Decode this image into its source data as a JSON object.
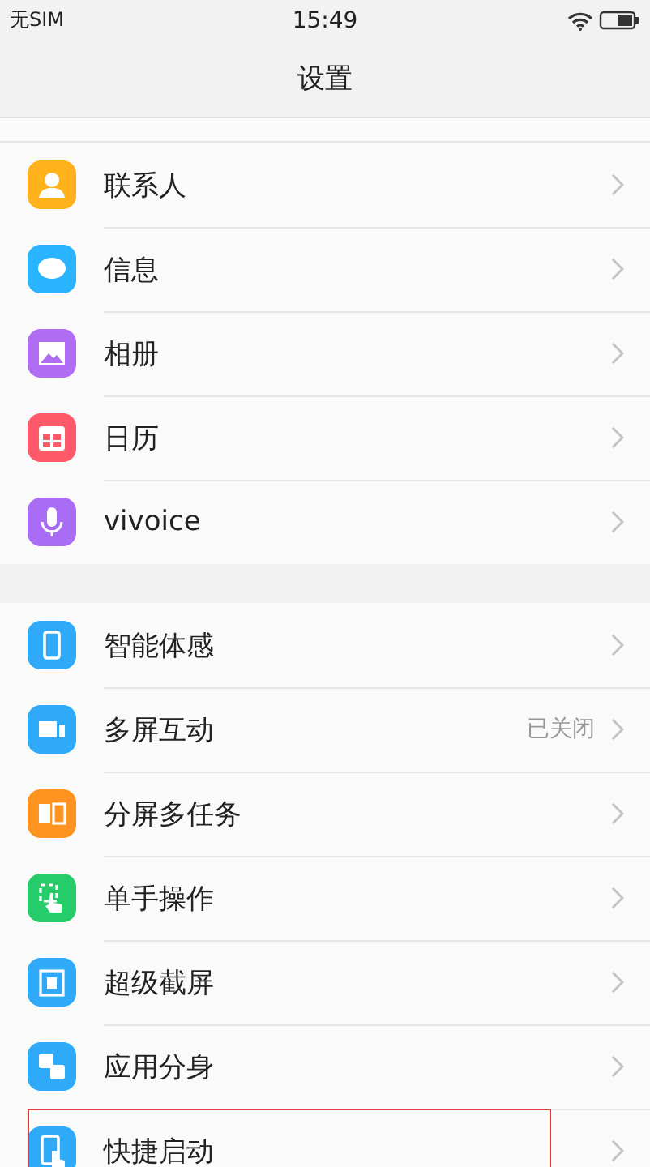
{
  "status_bar": {
    "carrier": "无SIM",
    "time": "15:49"
  },
  "title": "设置",
  "sections": [
    {
      "items": [
        {
          "label": "联系人",
          "highlighted": false
        },
        {
          "label": "信息",
          "highlighted": false
        },
        {
          "label": "相册",
          "highlighted": false
        },
        {
          "label": "日历",
          "highlighted": false
        },
        {
          "label": "vivoice",
          "highlighted": false
        }
      ]
    },
    {
      "items": [
        {
          "label": "智能体感",
          "highlighted": false
        },
        {
          "label": "多屏互动",
          "value": "已关闭",
          "highlighted": false
        },
        {
          "label": "分屏多任务",
          "highlighted": false
        },
        {
          "label": "单手操作",
          "highlighted": false
        },
        {
          "label": "超级截屏",
          "highlighted": false
        },
        {
          "label": "应用分身",
          "highlighted": false
        },
        {
          "label": "快捷启动",
          "highlighted": true
        }
      ]
    }
  ]
}
